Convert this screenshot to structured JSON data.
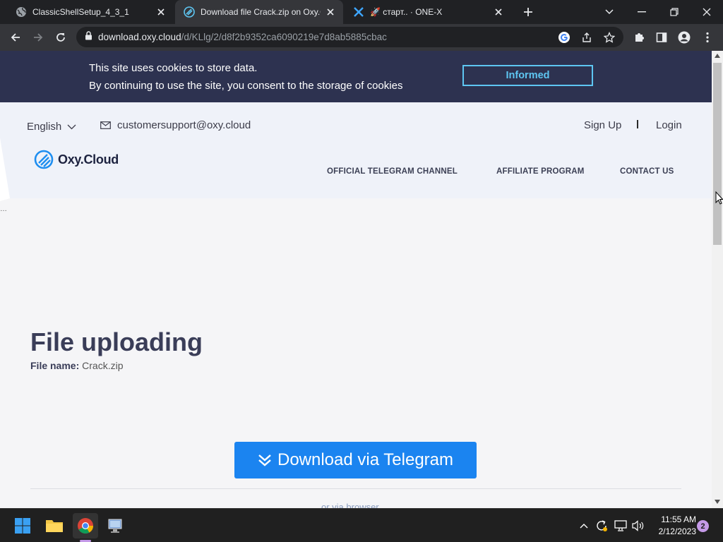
{
  "browser": {
    "tabs": [
      {
        "title": "ClassicShellSetup_4_3_1",
        "favicon": "globe-icon",
        "active": false
      },
      {
        "title": "Download file Crack.zip on Oxy.Cloud",
        "favicon": "oxy-cloud-icon",
        "active": true
      },
      {
        "title": "🚀 старт.. · ONE-X",
        "favicon": "onex-icon",
        "active": false
      }
    ],
    "address": {
      "host": "download.oxy.cloud",
      "path": "/d/KLlg/2/d8f2b9352ca6090219e7d8ab5885cbac"
    }
  },
  "cookie_banner": {
    "line1": "This site uses cookies to store data.",
    "line2": "By continuing to use the site, you consent to the storage of cookies",
    "button": "Informed"
  },
  "header": {
    "language": "English",
    "email": "customersupport@oxy.cloud",
    "sign_up": "Sign Up",
    "login": "Login",
    "logo": "Oxy.Cloud",
    "nav": [
      "OFFICIAL TELEGRAM CHANNEL",
      "AFFILIATE PROGRAM",
      "CONTACT US"
    ]
  },
  "main": {
    "heading": "File uploading",
    "file_label": "File name:",
    "file_name": "Crack.zip",
    "download_button": "Download via Telegram",
    "alt_link": "or via browser"
  },
  "taskbar": {
    "time": "11:55 AM",
    "date": "2/12/2023",
    "notifications": "2"
  },
  "colors": {
    "cookie_bg": "#2d3250",
    "accent_blue": "#1b84f0",
    "informed_border": "#5ec6f2",
    "heading": "#3a3d58"
  }
}
